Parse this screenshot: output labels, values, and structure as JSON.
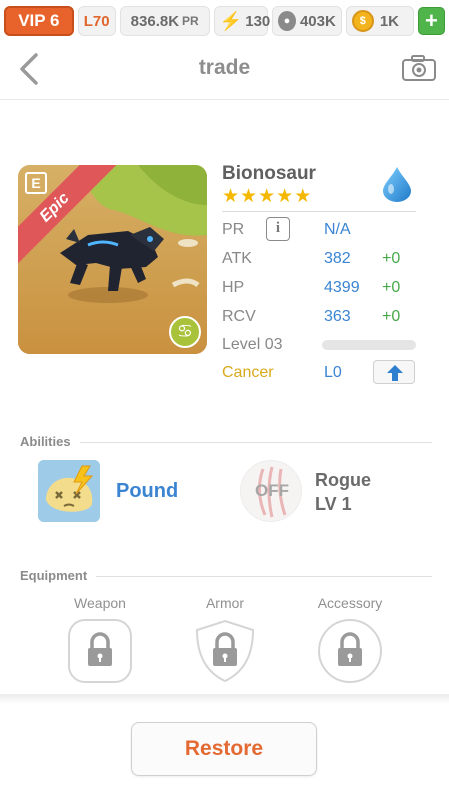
{
  "status_bar": {
    "vip": "VIP 6",
    "level": "L70",
    "pr_value": "836.8K",
    "pr_label": "PR",
    "energy": "130",
    "food": "403K",
    "gold": "1K",
    "plus": "+"
  },
  "header": {
    "title": "trade",
    "back_glyph": "<"
  },
  "monster": {
    "name": "Bionosaur",
    "rarity": "Epic",
    "stars": 5,
    "element": "water-drop-icon",
    "card_badge": "E",
    "zodiac_glyph": "♋",
    "stats": {
      "pr": {
        "label": "PR",
        "value": "N/A",
        "info_glyph": "i"
      },
      "atk": {
        "label": "ATK",
        "value": "382",
        "bonus": "+0"
      },
      "hp": {
        "label": "HP",
        "value": "4399",
        "bonus": "+0"
      },
      "rcv": {
        "label": "RCV",
        "value": "363",
        "bonus": "+0"
      },
      "level": {
        "label": "Level 03",
        "progress": 0.0
      },
      "zodiac": {
        "label": "Cancer",
        "value": "L0"
      }
    }
  },
  "abilities": {
    "heading": "Abilities",
    "primary": {
      "name": "Pound",
      "icon": "pound-icon"
    },
    "secondary": {
      "status": "OFF",
      "name": "Rogue",
      "level": "LV 1",
      "icon": "claw-icon"
    }
  },
  "equipment": {
    "heading": "Equipment",
    "slots": [
      {
        "label": "Weapon",
        "icon": "lock-icon"
      },
      {
        "label": "Armor",
        "icon": "lock-icon"
      },
      {
        "label": "Accessory",
        "icon": "lock-icon"
      }
    ]
  },
  "footer": {
    "restore_label": "Restore"
  },
  "colors": {
    "accent_orange": "#e8632b",
    "stat_blue": "#3b84d2",
    "bonus_green": "#47a84a",
    "rarity_red": "#e0575a",
    "star_gold": "#f5b800",
    "zodiac_gold": "#d8aa1e"
  }
}
